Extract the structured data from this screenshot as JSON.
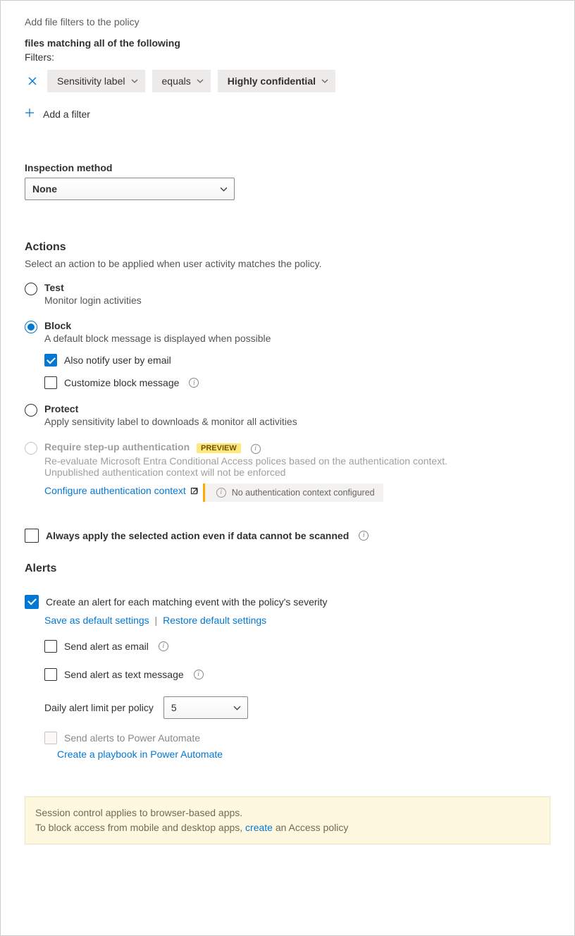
{
  "header": {
    "add_file_filters": "Add file filters to the policy",
    "matching_title": "files matching all of the following",
    "filters_label": "Filters:"
  },
  "filter": {
    "field": "Sensitivity label",
    "operator": "equals",
    "value": "Highly confidential",
    "add_filter": "Add a filter"
  },
  "inspection": {
    "label": "Inspection method",
    "value": "None"
  },
  "actions": {
    "title": "Actions",
    "desc": "Select an action to be applied when user activity matches the policy.",
    "test": {
      "title": "Test",
      "sub": "Monitor login activities",
      "selected": false
    },
    "block": {
      "title": "Block",
      "sub": "A default block message is displayed when possible",
      "selected": true,
      "notify_label": "Also notify user by email",
      "notify_checked": true,
      "customize_label": "Customize block message",
      "customize_checked": false
    },
    "protect": {
      "title": "Protect",
      "sub": "Apply sensitivity label to downloads & monitor all activities",
      "selected": false
    },
    "stepup": {
      "title": "Require step-up authentication",
      "badge": "PREVIEW",
      "sub": "Re-evaluate Microsoft Entra Conditional Access polices based on the authentication context. Unpublished authentication context will not be enforced",
      "configure_link": "Configure authentication context",
      "warn": "No authentication context configured"
    },
    "always_apply": {
      "label": "Always apply the selected action even if data cannot be scanned",
      "checked": false
    }
  },
  "alerts": {
    "title": "Alerts",
    "create_label": "Create an alert for each matching event with the policy's severity",
    "create_checked": true,
    "save_default": "Save as default settings",
    "restore_default": "Restore default settings",
    "email_label": "Send alert as email",
    "email_checked": false,
    "sms_label": "Send alert as text message",
    "sms_checked": false,
    "daily_label": "Daily alert limit per policy",
    "daily_value": "5",
    "power_automate_label": "Send alerts to Power Automate",
    "power_automate_checked": false,
    "playbook_link": "Create a playbook in Power Automate"
  },
  "footer": {
    "line1": "Session control applies to browser-based apps.",
    "line2a": "To block access from mobile and desktop apps, ",
    "link": "create",
    "line2b": " an Access policy"
  }
}
